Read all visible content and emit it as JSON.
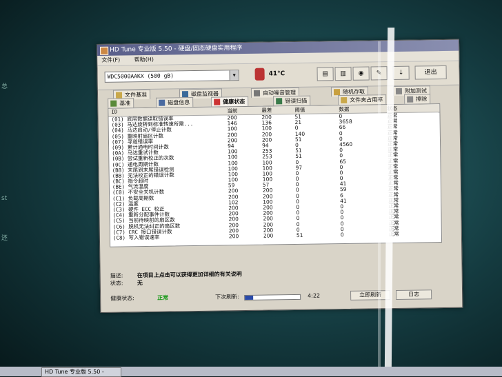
{
  "window": {
    "title": "HD Tune 专业版 5.50 - 硬盘/固态硬盘实用程序",
    "menu": [
      "文件(F)",
      "帮助(H)"
    ],
    "drive": "WDC5000AAKX (500 gB)",
    "temperature": "41°C",
    "exit": "退出"
  },
  "tabs_row1": [
    {
      "label": "文件基准",
      "icon": "file-icon"
    },
    {
      "label": "磁盘监视器",
      "icon": "monitor-icon"
    },
    {
      "label": "自动噪音管理",
      "icon": "speaker-icon"
    },
    {
      "label": "随机存取",
      "icon": "random-icon"
    },
    {
      "label": "附加测试",
      "icon": "extra-icon"
    }
  ],
  "tabs_row2": [
    {
      "label": "基准",
      "icon": "benchmark-icon"
    },
    {
      "label": "磁盘信息",
      "icon": "disk-icon"
    },
    {
      "label": "健康状态",
      "icon": "health-icon",
      "active": true
    },
    {
      "label": "错误扫描",
      "icon": "scan-icon"
    },
    {
      "label": "文件夹占用率",
      "icon": "folder-icon"
    },
    {
      "label": "擦除",
      "icon": "erase-icon"
    }
  ],
  "table": {
    "headers": {
      "id": "ID",
      "current": "当前",
      "worst": "最差",
      "threshold": "阈值",
      "data": "数据",
      "status": "状态"
    },
    "rows": [
      {
        "id": "(01) 底层数据读取错误率",
        "current": "200",
        "worst": "200",
        "threshold": "51",
        "data": "0",
        "status": "正常"
      },
      {
        "id": "(03) 马达旋转到标准转速所需...",
        "current": "146",
        "worst": "136",
        "threshold": "21",
        "data": "3658",
        "status": "正常"
      },
      {
        "id": "(04) 马达启动/停止计数",
        "current": "100",
        "worst": "100",
        "threshold": "0",
        "data": "66",
        "status": "正常"
      },
      {
        "id": "(05) 重映射扇区计数",
        "current": "200",
        "worst": "200",
        "threshold": "140",
        "data": "0",
        "status": "正常"
      },
      {
        "id": "(07) 寻道错误率",
        "current": "200",
        "worst": "200",
        "threshold": "51",
        "data": "0",
        "status": "正常"
      },
      {
        "id": "(09) 累计通电时间计数",
        "current": "94",
        "worst": "94",
        "threshold": "0",
        "data": "4560",
        "status": "正常"
      },
      {
        "id": "(0A) 马达重试计数",
        "current": "100",
        "worst": "253",
        "threshold": "51",
        "data": "0",
        "status": "正常"
      },
      {
        "id": "(0B) 尝试重新校正的次数",
        "current": "100",
        "worst": "253",
        "threshold": "51",
        "data": "0",
        "status": "正常"
      },
      {
        "id": "(0C) 通电周期计数",
        "current": "100",
        "worst": "100",
        "threshold": "0",
        "data": "65",
        "status": "正常"
      },
      {
        "id": "(B8) 末尾到末尾错误检测",
        "current": "100",
        "worst": "100",
        "threshold": "97",
        "data": "0",
        "status": "正常"
      },
      {
        "id": "(BB) 无法校正的错误计数",
        "current": "100",
        "worst": "100",
        "threshold": "0",
        "data": "0",
        "status": "正常"
      },
      {
        "id": "(BC) 指令超时",
        "current": "100",
        "worst": "100",
        "threshold": "0",
        "data": "0",
        "status": "正常"
      },
      {
        "id": "(BE) 气流温度",
        "current": "59",
        "worst": "57",
        "threshold": "0",
        "data": "41",
        "status": "正常"
      },
      {
        "id": "(C0) 不安全关机计数",
        "current": "200",
        "worst": "200",
        "threshold": "0",
        "data": "59",
        "status": "正常"
      },
      {
        "id": "(C1) 负载周期数",
        "current": "200",
        "worst": "200",
        "threshold": "0",
        "data": "6",
        "status": "正常"
      },
      {
        "id": "(C2) 温度",
        "current": "102",
        "worst": "100",
        "threshold": "0",
        "data": "41",
        "status": "正常"
      },
      {
        "id": "(C3) 硬件 ECC 校正",
        "current": "200",
        "worst": "200",
        "threshold": "0",
        "data": "0",
        "status": "正常"
      },
      {
        "id": "(C4) 重新分配事件计数",
        "current": "200",
        "worst": "200",
        "threshold": "0",
        "data": "0",
        "status": "正常"
      },
      {
        "id": "(C5) 当前待映射的扇区数",
        "current": "200",
        "worst": "200",
        "threshold": "0",
        "data": "0",
        "status": "正常"
      },
      {
        "id": "(C6) 脱机无法纠正的扇区数",
        "current": "200",
        "worst": "200",
        "threshold": "0",
        "data": "0",
        "status": "正常"
      },
      {
        "id": "(C7) CRC 接口错误计数",
        "current": "200",
        "worst": "200",
        "threshold": "0",
        "data": "0",
        "status": "正常"
      },
      {
        "id": "(C8) 写入错误速率",
        "current": "200",
        "worst": "200",
        "threshold": "51",
        "data": "0",
        "status": "正常"
      }
    ]
  },
  "description": {
    "desc_label": "描述:",
    "desc_value": "在项目上点击可以获得更加详细的有关说明",
    "status_label": "状态:",
    "status_value": "无"
  },
  "statusbar": {
    "health_label": "健康状态:",
    "health_value": "正常",
    "next_refresh_label": "下次刷新:",
    "refresh_progress": 0.15,
    "time": "4:22",
    "refresh_button": "立即刷新",
    "log_button": "日志"
  },
  "taskbar": {
    "item": "HD Tune 专业版 5.50 -"
  },
  "colors": {
    "health_ok": "#1a9a1a",
    "titlebar": "#5a5f8a"
  }
}
